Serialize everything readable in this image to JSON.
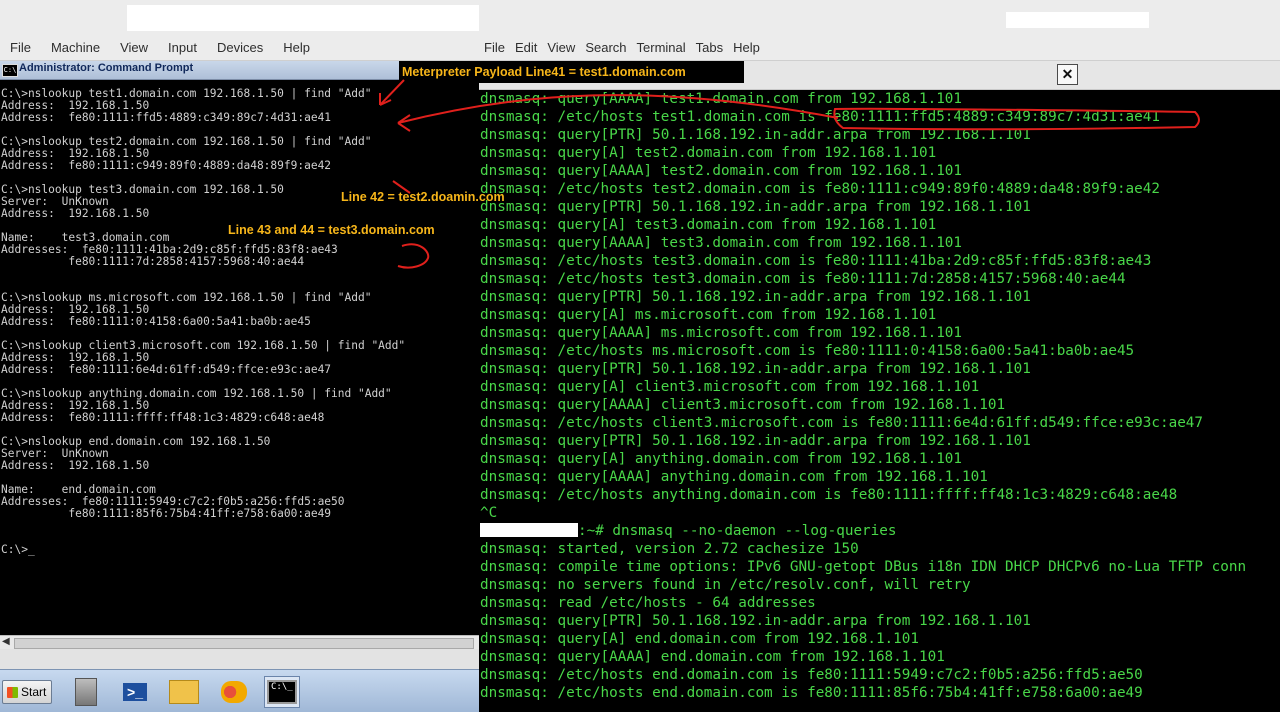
{
  "vm": {
    "menu": [
      "File",
      "Machine",
      "View",
      "Input",
      "Devices",
      "Help"
    ],
    "cmd_window": {
      "title": "Administrator: Command Prompt",
      "lines": [
        "C:\\>nslookup test1.domain.com 192.168.1.50 | find \"Add\"",
        "Address:  192.168.1.50",
        "Address:  fe80:1111:ffd5:4889:c349:89c7:4d31:ae41",
        "",
        "C:\\>nslookup test2.domain.com 192.168.1.50 | find \"Add\"",
        "Address:  192.168.1.50",
        "Address:  fe80:1111:c949:89f0:4889:da48:89f9:ae42",
        "",
        "C:\\>nslookup test3.domain.com 192.168.1.50",
        "Server:  UnKnown",
        "Address:  192.168.1.50",
        "",
        "Name:    test3.domain.com",
        "Addresses:  fe80:1111:41ba:2d9:c85f:ffd5:83f8:ae43",
        "          fe80:1111:7d:2858:4157:5968:40:ae44",
        "",
        "",
        "C:\\>nslookup ms.microsoft.com 192.168.1.50 | find \"Add\"",
        "Address:  192.168.1.50",
        "Address:  fe80:1111:0:4158:6a00:5a41:ba0b:ae45",
        "",
        "C:\\>nslookup client3.microsoft.com 192.168.1.50 | find \"Add\"",
        "Address:  192.168.1.50",
        "Address:  fe80:1111:6e4d:61ff:d549:ffce:e93c:ae47",
        "",
        "C:\\>nslookup anything.domain.com 192.168.1.50 | find \"Add\"",
        "Address:  192.168.1.50",
        "Address:  fe80:1111:ffff:ff48:1c3:4829:c648:ae48",
        "",
        "C:\\>nslookup end.domain.com 192.168.1.50",
        "Server:  UnKnown",
        "Address:  192.168.1.50",
        "",
        "Name:    end.domain.com",
        "Addresses:  fe80:1111:5949:c7c2:f0b5:a256:ffd5:ae50",
        "          fe80:1111:85f6:75b4:41ff:e758:6a00:ae49",
        "",
        "",
        "C:\\>_"
      ]
    },
    "taskbar": {
      "start_label": "Start",
      "cmd_icon_text": "C:\\_"
    }
  },
  "terminal": {
    "menu": [
      "File",
      "Edit",
      "View",
      "Search",
      "Terminal",
      "Tabs",
      "Help"
    ],
    "close_glyph": "✕",
    "lines_top": [
      "dnsmasq: query[AAAA] test1.domain.com from 192.168.1.101",
      "dnsmasq: /etc/hosts test1.domain.com is fe80:1111:ffd5:4889:c349:89c7:4d31:ae41",
      "dnsmasq: query[PTR] 50.1.168.192.in-addr.arpa from 192.168.1.101",
      "dnsmasq: query[A] test2.domain.com from 192.168.1.101",
      "dnsmasq: query[AAAA] test2.domain.com from 192.168.1.101",
      "dnsmasq: /etc/hosts test2.domain.com is fe80:1111:c949:89f0:4889:da48:89f9:ae42",
      "dnsmasq: query[PTR] 50.1.168.192.in-addr.arpa from 192.168.1.101",
      "dnsmasq: query[A] test3.domain.com from 192.168.1.101",
      "dnsmasq: query[AAAA] test3.domain.com from 192.168.1.101",
      "dnsmasq: /etc/hosts test3.domain.com is fe80:1111:41ba:2d9:c85f:ffd5:83f8:ae43",
      "dnsmasq: /etc/hosts test3.domain.com is fe80:1111:7d:2858:4157:5968:40:ae44",
      "dnsmasq: query[PTR] 50.1.168.192.in-addr.arpa from 192.168.1.101",
      "dnsmasq: query[A] ms.microsoft.com from 192.168.1.101",
      "dnsmasq: query[AAAA] ms.microsoft.com from 192.168.1.101",
      "dnsmasq: /etc/hosts ms.microsoft.com is fe80:1111:0:4158:6a00:5a41:ba0b:ae45",
      "dnsmasq: query[PTR] 50.1.168.192.in-addr.arpa from 192.168.1.101",
      "dnsmasq: query[A] client3.microsoft.com from 192.168.1.101",
      "dnsmasq: query[AAAA] client3.microsoft.com from 192.168.1.101",
      "dnsmasq: /etc/hosts client3.microsoft.com is fe80:1111:6e4d:61ff:d549:ffce:e93c:ae47",
      "dnsmasq: query[PTR] 50.1.168.192.in-addr.arpa from 192.168.1.101",
      "dnsmasq: query[A] anything.domain.com from 192.168.1.101",
      "dnsmasq: query[AAAA] anything.domain.com from 192.168.1.101",
      "dnsmasq: /etc/hosts anything.domain.com is fe80:1111:ffff:ff48:1c3:4829:c648:ae48",
      "^C"
    ],
    "prompt_suffix": ":~# dnsmasq --no-daemon --log-queries",
    "lines_bottom": [
      "dnsmasq: started, version 2.72 cachesize 150",
      "dnsmasq: compile time options: IPv6 GNU-getopt DBus i18n IDN DHCP DHCPv6 no-Lua TFTP conn",
      "dnsmasq: no servers found in /etc/resolv.conf, will retry",
      "dnsmasq: read /etc/hosts - 64 addresses",
      "dnsmasq: query[PTR] 50.1.168.192.in-addr.arpa from 192.168.1.101",
      "dnsmasq: query[A] end.domain.com from 192.168.1.101",
      "dnsmasq: query[AAAA] end.domain.com from 192.168.1.101",
      "dnsmasq: /etc/hosts end.domain.com is fe80:1111:5949:c7c2:f0b5:a256:ffd5:ae50",
      "dnsmasq: /etc/hosts end.domain.com is fe80:1111:85f6:75b4:41ff:e758:6a00:ae49"
    ]
  },
  "annotations": {
    "note1": "Meterpreter Payload Line41  = test1.domain.com",
    "note2": "Line 42 = test2.doamin.com",
    "note3": "Line 43 and 44 = test3.domain.com",
    "annotation_color": "#f7b61a",
    "arrow_color": "#e0201c"
  }
}
